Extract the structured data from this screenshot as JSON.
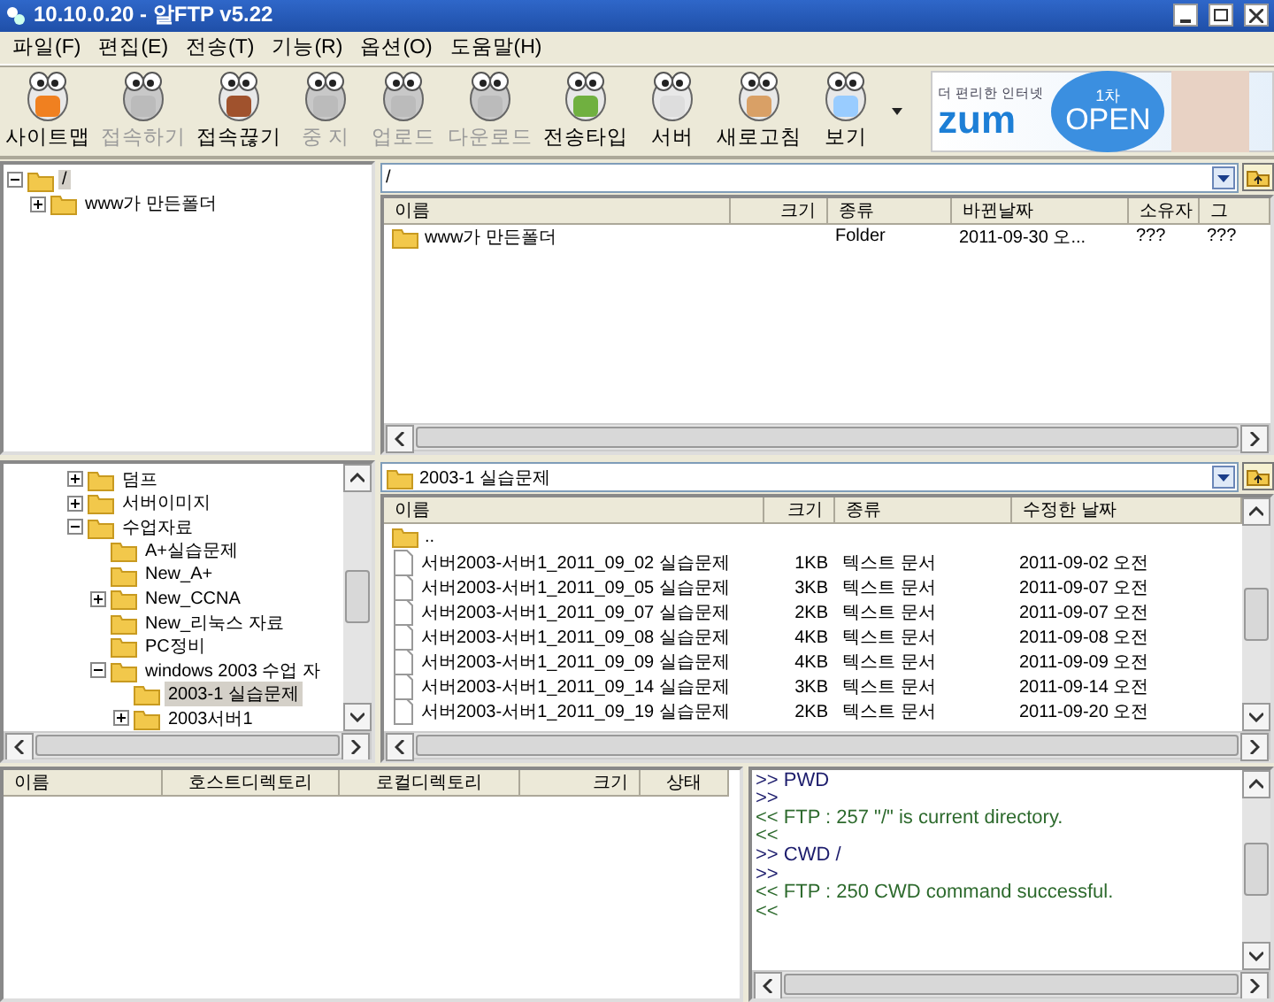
{
  "window": {
    "title": "10.10.0.20 - 알FTP v5.22"
  },
  "menu": [
    "파일(F)",
    "편집(E)",
    "전송(T)",
    "기능(R)",
    "옵션(O)",
    "도움말(H)"
  ],
  "toolbar": [
    {
      "label": "사이트맵",
      "disabled": false
    },
    {
      "label": "접속하기",
      "disabled": true
    },
    {
      "label": "접속끊기",
      "disabled": false
    },
    {
      "label": "중 지",
      "disabled": true
    },
    {
      "label": "업로드",
      "disabled": true
    },
    {
      "label": "다운로드",
      "disabled": true
    },
    {
      "label": "전송타입",
      "disabled": false
    },
    {
      "label": "서버",
      "disabled": false
    },
    {
      "label": "새로고침",
      "disabled": false
    },
    {
      "label": "보기",
      "disabled": false
    }
  ],
  "banner": {
    "tagline": "더 편리한 인터넷",
    "brand": "zum",
    "badge_top": "1차",
    "badge_main": "OPEN"
  },
  "remote_tree": [
    {
      "label": "/",
      "selected": true,
      "expanded": true,
      "children": [
        {
          "label": "www가 만든폴더",
          "selected": false,
          "expanded": false
        }
      ]
    }
  ],
  "remote_list": {
    "path": "/",
    "columns": [
      "이름",
      "크기",
      "종류",
      "바뀐날짜",
      "소유자",
      "그"
    ],
    "rows": [
      {
        "name": "www가 만든폴더",
        "type": "Folder",
        "date": "2011-09-30 오...",
        "owner": "???",
        "group": "???"
      }
    ]
  },
  "local_tree": [
    {
      "label": "덤프",
      "selected": false,
      "expanded": false
    },
    {
      "label": "서버이미지",
      "selected": false,
      "expanded": false
    },
    {
      "label": "수업자료",
      "selected": false,
      "expanded": true,
      "children": [
        {
          "label": "A+실습문제",
          "selected": false
        },
        {
          "label": "New_A+",
          "selected": false
        },
        {
          "label": "New_CCNA",
          "selected": false,
          "expanded": false
        },
        {
          "label": "New_리눅스 자료",
          "selected": false
        },
        {
          "label": "PC정비",
          "selected": false
        },
        {
          "label": "windows 2003 수업 자",
          "selected": false,
          "expanded": true,
          "children": [
            {
              "label": "2003-1 실습문제",
              "selected": true
            },
            {
              "label": "2003서버1",
              "selected": false,
              "expanded": false
            }
          ]
        }
      ]
    }
  ],
  "local_list": {
    "path": "2003-1 실습문제",
    "columns": [
      "이름",
      "크기",
      "종류",
      "수정한 날짜"
    ],
    "rows": [
      {
        "kind": "folder",
        "name": ".."
      },
      {
        "kind": "file",
        "name": "서버2003-서버1_2011_09_02 실습문제",
        "size": "1KB",
        "type": "텍스트 문서",
        "date": "2011-09-02 오전"
      },
      {
        "kind": "file",
        "name": "서버2003-서버1_2011_09_05 실습문제",
        "size": "3KB",
        "type": "텍스트 문서",
        "date": "2011-09-07 오전"
      },
      {
        "kind": "file",
        "name": "서버2003-서버1_2011_09_07 실습문제",
        "size": "2KB",
        "type": "텍스트 문서",
        "date": "2011-09-07 오전"
      },
      {
        "kind": "file",
        "name": "서버2003-서버1_2011_09_08 실습문제",
        "size": "4KB",
        "type": "텍스트 문서",
        "date": "2011-09-08 오전"
      },
      {
        "kind": "file",
        "name": "서버2003-서버1_2011_09_09 실습문제",
        "size": "4KB",
        "type": "텍스트 문서",
        "date": "2011-09-09 오전"
      },
      {
        "kind": "file",
        "name": "서버2003-서버1_2011_09_14 실습문제",
        "size": "3KB",
        "type": "텍스트 문서",
        "date": "2011-09-14 오전"
      },
      {
        "kind": "file",
        "name": "서버2003-서버1_2011_09_19 실습문제",
        "size": "2KB",
        "type": "텍스트 문서",
        "date": "2011-09-20 오전"
      }
    ]
  },
  "queue": {
    "columns": [
      "이름",
      "호스트디렉토리",
      "로컬디렉토리",
      "크기",
      "상태"
    ]
  },
  "log": [
    {
      "kind": "command",
      "text": ">> PWD"
    },
    {
      "kind": "command",
      "text": ">>"
    },
    {
      "kind": "reply",
      "text": "<< FTP : 257 \"/\" is current directory."
    },
    {
      "kind": "reply",
      "text": "<<"
    },
    {
      "kind": "command",
      "text": ">> CWD /"
    },
    {
      "kind": "command",
      "text": ">>"
    },
    {
      "kind": "reply",
      "text": "<< FTP : 250 CWD command successful."
    },
    {
      "kind": "reply",
      "text": "<<"
    }
  ]
}
